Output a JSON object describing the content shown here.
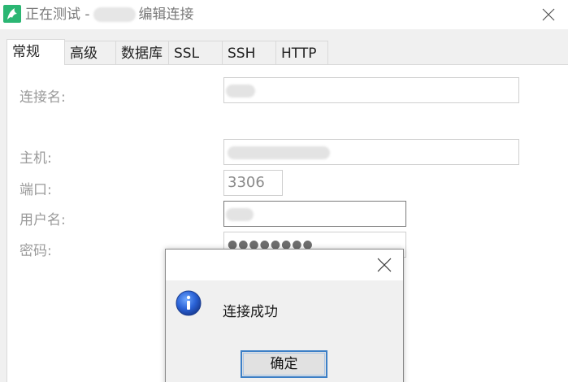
{
  "window": {
    "title_prefix": "正在测试 -",
    "title_suffix": "编辑连接",
    "app_icon": "dolphin-icon",
    "close_icon": "close-icon"
  },
  "tabs": [
    {
      "label": "常规",
      "active": true
    },
    {
      "label": "高级",
      "active": false
    },
    {
      "label": "数据库",
      "active": false
    },
    {
      "label": "SSL",
      "active": false
    },
    {
      "label": "SSH",
      "active": false
    },
    {
      "label": "HTTP",
      "active": false
    }
  ],
  "form": {
    "connection_name_label": "连接名:",
    "host_label": "主机:",
    "port_label": "端口:",
    "port_value": "3306",
    "username_label": "用户名:",
    "password_label": "密码:",
    "password_mask": "●●●●●●●●"
  },
  "dialog": {
    "message": "连接成功",
    "ok_label": "确定",
    "icon": "info-icon",
    "accent": "#3c7fc6"
  }
}
